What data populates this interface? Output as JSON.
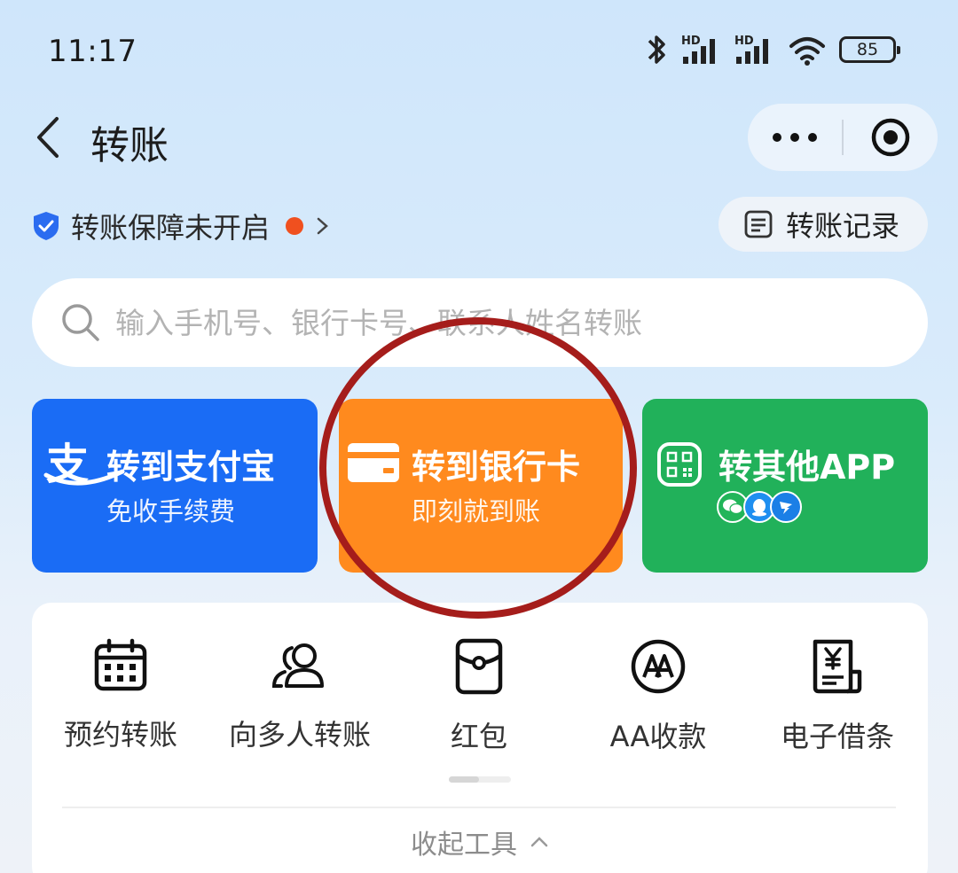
{
  "status_bar": {
    "time": "11:17",
    "battery": "85",
    "signal1_label": "HD",
    "signal2_label": "HD"
  },
  "header": {
    "title": "转账"
  },
  "guarantee": {
    "label": "转账保障未开启"
  },
  "records": {
    "label": "转账记录"
  },
  "search": {
    "placeholder": "输入手机号、银行卡号、联系人姓名转账"
  },
  "cards": [
    {
      "title": "转到支付宝",
      "subtitle": "免收手续费"
    },
    {
      "title": "转到银行卡",
      "subtitle": "即刻就到账"
    },
    {
      "title": "转其他APP"
    }
  ],
  "tools": [
    {
      "label": "预约转账"
    },
    {
      "label": "向多人转账"
    },
    {
      "label": "红包"
    },
    {
      "label": "AA收款"
    },
    {
      "label": "电子借条"
    }
  ],
  "collapse": {
    "label": "收起工具"
  },
  "colors": {
    "alipay_blue": "#1a6cf5",
    "bank_orange": "#ff8a1e",
    "other_green": "#21b15a",
    "annotation_red": "#a51d1b"
  }
}
